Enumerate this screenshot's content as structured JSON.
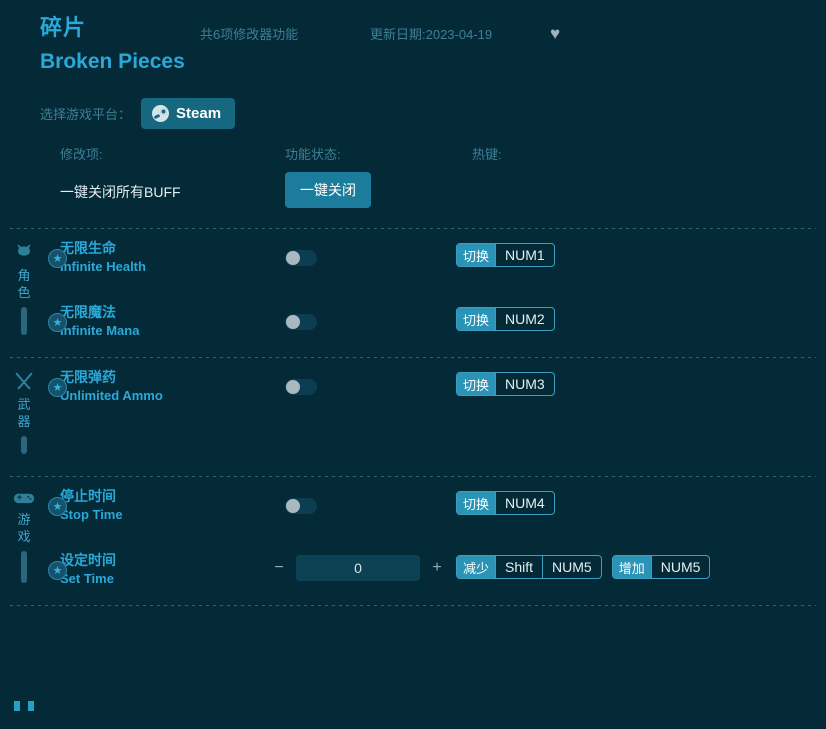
{
  "header": {
    "title_cn": "碎片",
    "title_en": "Broken Pieces",
    "feature_count": "共6项修改器功能",
    "update_date": "更新日期:2023-04-19",
    "favorite_icon": "♥"
  },
  "platform": {
    "label": "选择游戏平台：",
    "selected": "Steam"
  },
  "columns": {
    "mod": "修改项:",
    "state": "功能状态:",
    "hotkey": "热键:"
  },
  "buff": {
    "label": "一键关闭所有BUFF",
    "button": "一键关闭"
  },
  "star": "★",
  "sections": [
    {
      "aside_label": "角色",
      "aside_icon": "armor-helmet-icon",
      "rows": [
        {
          "name_cn": "无限生命",
          "name_en": "Infinite Health",
          "control": "toggle",
          "toggle_on": false,
          "hotkeys": [
            {
              "action": "切换",
              "key": "NUM1"
            }
          ]
        },
        {
          "name_cn": "无限魔法",
          "name_en": "Infinite Mana",
          "control": "toggle",
          "toggle_on": false,
          "hotkeys": [
            {
              "action": "切换",
              "key": "NUM2"
            }
          ]
        }
      ]
    },
    {
      "aside_label": "武器",
      "aside_icon": "crossed-swords-icon",
      "rows": [
        {
          "name_cn": "无限弹药",
          "name_en": "Unlimited Ammo",
          "control": "toggle",
          "toggle_on": false,
          "hotkeys": [
            {
              "action": "切换",
              "key": "NUM3"
            }
          ]
        }
      ]
    },
    {
      "aside_label": "游戏",
      "aside_icon": "gamepad-icon",
      "rows": [
        {
          "name_cn": "停止时间",
          "name_en": "Stop Time",
          "control": "toggle",
          "toggle_on": false,
          "hotkeys": [
            {
              "action": "切换",
              "key": "NUM4"
            }
          ]
        },
        {
          "name_cn": "设定时间",
          "name_en": "Set Time",
          "control": "stepper",
          "value": "0",
          "minus": "−",
          "plus": "+",
          "hotkeys": [
            {
              "action": "减少",
              "key": "Shift",
              "key2": "NUM5"
            },
            {
              "action": "增加",
              "key": "NUM5"
            }
          ]
        }
      ]
    }
  ],
  "colors": {
    "background": "#042a38",
    "accent": "#2aa8d8",
    "muted": "#3d7f94",
    "button": "#15687f"
  }
}
